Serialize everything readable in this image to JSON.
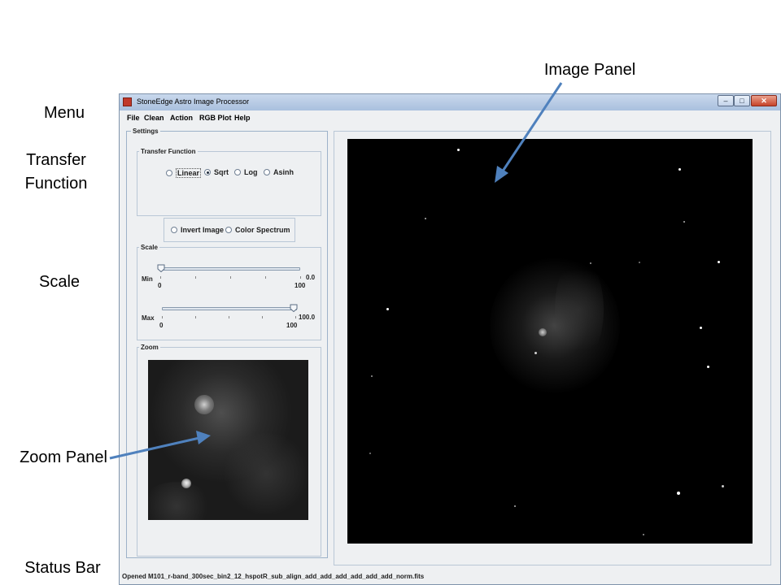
{
  "annotations": {
    "image_panel": "Image Panel",
    "menu": "Menu",
    "transfer_function_line1": "Transfer",
    "transfer_function_line2": "Function",
    "scale": "Scale",
    "zoom_panel": "Zoom Panel",
    "status_bar": "Status Bar",
    "arrow_color": "#4f81bd"
  },
  "window": {
    "title": "StoneEdge Astro Image Processor",
    "controls": {
      "minimize": "‒",
      "maximize": "□",
      "close": "✕"
    }
  },
  "menu": [
    "File",
    "Clean",
    "Action",
    "RGB Plot",
    "Help"
  ],
  "settings": {
    "title": "Settings",
    "transfer_function": {
      "title": "Transfer Function",
      "options": [
        "Linear",
        "Sqrt",
        "Log",
        "Asinh"
      ],
      "selected": "Sqrt"
    },
    "invert_image": "Invert Image",
    "color_spectrum": "Color Spectrum",
    "scale": {
      "title": "Scale",
      "min": {
        "label": "Min",
        "value": "0.0",
        "tick_start": "0",
        "tick_end": "100",
        "position": 0
      },
      "max": {
        "label": "Max",
        "value": "100.0",
        "tick_start": "0",
        "tick_end": "100",
        "position": 100
      }
    },
    "zoom": {
      "title": "Zoom"
    }
  },
  "status_bar": "Opened M101_r-band_300sec_bin2_12_hspotR_sub_align_add_add_add_add_add_add_norm.fits"
}
